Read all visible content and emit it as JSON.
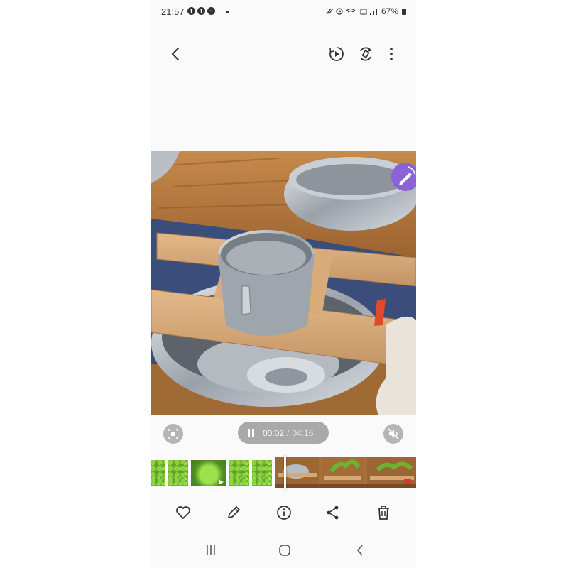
{
  "status_bar": {
    "time": "21:57",
    "notification_icons": [
      "facebook-icon",
      "facebook-icon",
      "messenger-icon"
    ],
    "battery": "67%"
  },
  "top_bar": {
    "back_icon": "chevron-left-icon",
    "actions": [
      "video-player-icon",
      "rotate-icon",
      "more-options-icon"
    ]
  },
  "video": {
    "overlay_icon": "edit-icon"
  },
  "playback": {
    "current_time": "00:02",
    "separator": "/",
    "duration": "04:16",
    "progress": 0.008,
    "left_control_icon": "capture-frame-icon",
    "right_control_icon": "mute-icon"
  },
  "toolbar": {
    "items": [
      "favorite-icon",
      "edit-icon",
      "info-icon",
      "share-icon",
      "delete-icon"
    ]
  },
  "nav_bar": {
    "items": [
      "recent-apps-icon",
      "home-icon",
      "back-icon"
    ]
  },
  "colors": {
    "accent_purple": "#8a64d6",
    "control_grey": "#a9a9a9",
    "wood": "#b87a3d"
  }
}
